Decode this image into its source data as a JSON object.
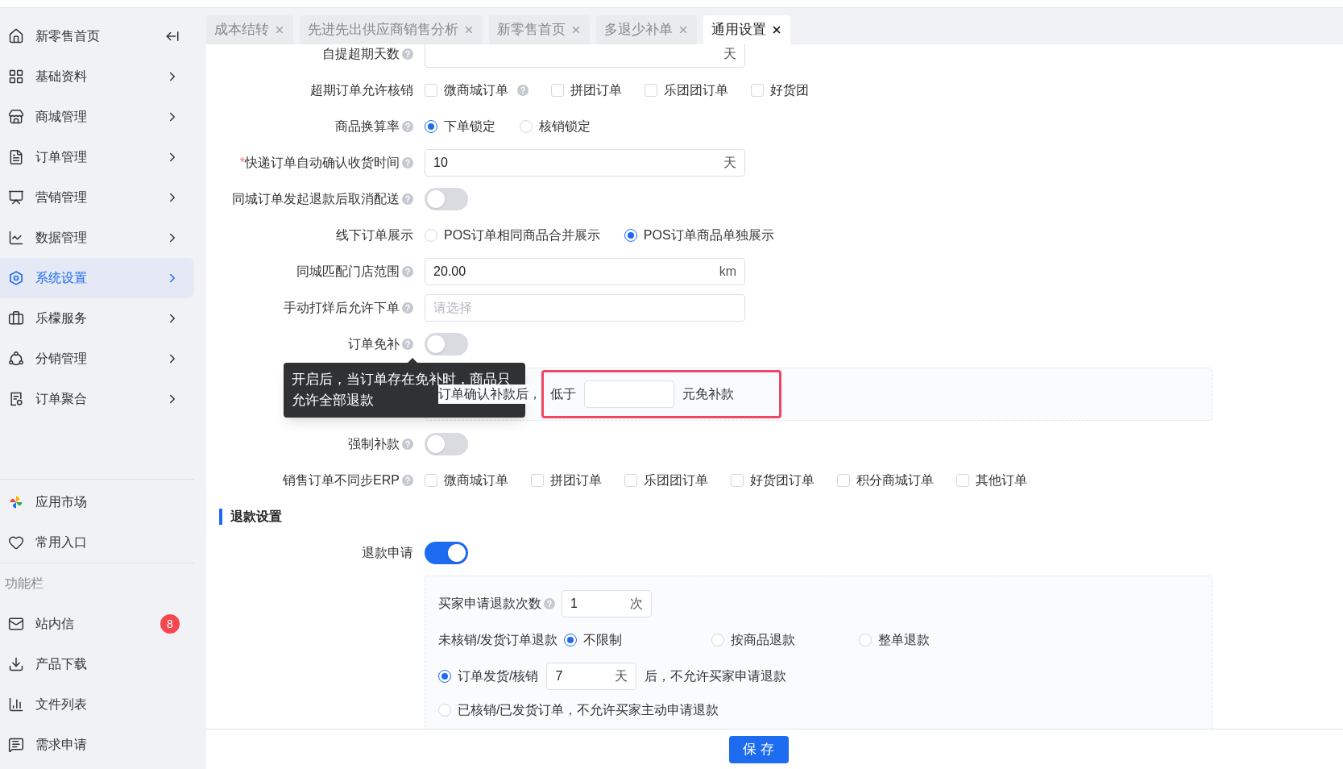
{
  "sidebar": {
    "menu": [
      {
        "label": "新零售首页",
        "kind": "home",
        "selected": false
      },
      {
        "label": "基础资料",
        "kind": "grid",
        "selected": false
      },
      {
        "label": "商城管理",
        "kind": "store",
        "selected": false
      },
      {
        "label": "订单管理",
        "kind": "order",
        "selected": false
      },
      {
        "label": "营销管理",
        "kind": "marketing",
        "selected": false
      },
      {
        "label": "数据管理",
        "kind": "data",
        "selected": false
      },
      {
        "label": "系统设置",
        "kind": "settings",
        "selected": true
      },
      {
        "label": "乐檬服务",
        "kind": "service",
        "selected": false
      },
      {
        "label": "分销管理",
        "kind": "distribution",
        "selected": false
      },
      {
        "label": "订单聚合",
        "kind": "aggregate",
        "selected": false
      }
    ],
    "apps": [
      {
        "label": "应用市场",
        "kind": "market"
      },
      {
        "label": "常用入口",
        "kind": "favorite"
      }
    ],
    "section_title": "功能栏",
    "tools": [
      {
        "label": "站内信",
        "kind": "mail",
        "badge": "8"
      },
      {
        "label": "产品下载",
        "kind": "download"
      },
      {
        "label": "文件列表",
        "kind": "files"
      },
      {
        "label": "需求申请",
        "kind": "request"
      }
    ]
  },
  "tabs": [
    {
      "label": "成本结转",
      "selected": false
    },
    {
      "label": "先进先出供应商销售分析",
      "selected": false
    },
    {
      "label": "新零售首页",
      "selected": false
    },
    {
      "label": "多退少补单",
      "selected": false
    },
    {
      "label": "通用设置",
      "selected": true
    }
  ],
  "form": [
    {
      "kind": "input",
      "label": "自提超期天数",
      "help": true,
      "suffix": "天"
    },
    {
      "kind": "checkboxes",
      "label": "超期订单允许核销",
      "help": false,
      "options": [
        {
          "label": "微商城订单",
          "checked": false,
          "help": true
        },
        {
          "label": "拼团订单",
          "checked": false,
          "help": false
        },
        {
          "label": "乐团团订单",
          "checked": false,
          "help": false
        },
        {
          "label": "好货团",
          "checked": false,
          "help": false
        }
      ]
    },
    {
      "kind": "radios",
      "label": "商品换算率",
      "help": true,
      "options": [
        {
          "label": "下单锁定",
          "selected": true
        },
        {
          "label": "核销锁定",
          "selected": false
        }
      ]
    },
    {
      "kind": "input",
      "label": "快递订单自动确认收货时间",
      "required_mark": "*",
      "help": true,
      "value": "10",
      "suffix": "天"
    },
    {
      "kind": "switch",
      "label": "同城订单发起退款后取消配送",
      "help": true,
      "on": false
    },
    {
      "kind": "radios",
      "label": "线下订单展示",
      "help": false,
      "options": [
        {
          "label": "POS订单相同商品合并展示",
          "selected": false
        },
        {
          "label": "POS订单商品单独展示",
          "selected": true
        }
      ]
    },
    {
      "kind": "input",
      "label": "同城匹配门店范围",
      "help": true,
      "value": "20.00",
      "suffix": "km"
    },
    {
      "kind": "input",
      "label": "手动打烊后允许下单",
      "help": true,
      "placeholder": "请选择"
    },
    {
      "kind": "switch",
      "label": "订单免补",
      "help": true,
      "on": false,
      "tooltip": "开启后，当订单存在免补时，商品只允许全部退款"
    },
    {
      "kind": "threshold",
      "text": "订单确认补款后，",
      "prefix": "低于",
      "suffix": "元免补款",
      "highlighted": true
    },
    {
      "kind": "switch",
      "label": "强制补款",
      "help": true,
      "on": false
    },
    {
      "kind": "checkboxes",
      "label": "销售订单不同步ERP",
      "help": true,
      "options": [
        {
          "label": "微商城订单",
          "checked": false,
          "help": false
        },
        {
          "label": "拼团订单",
          "checked": false,
          "help": false
        },
        {
          "label": "乐团团订单",
          "checked": false,
          "help": false
        },
        {
          "label": "好货团订单",
          "checked": false,
          "help": false
        },
        {
          "label": "积分商城订单",
          "checked": false,
          "help": false
        },
        {
          "label": "其他订单",
          "checked": false,
          "help": false
        }
      ]
    }
  ],
  "refund": {
    "title": "退款设置",
    "switch": {
      "label": "退款申请",
      "help": false,
      "on": true
    },
    "rows": [
      {
        "kind": "count",
        "label": "买家申请退款次数",
        "help": true,
        "value": "1",
        "suffix": "次"
      },
      {
        "kind": "radios",
        "label": "未核销/发货订单退款",
        "options": [
          {
            "label": "不限制",
            "selected": true
          },
          {
            "label": "按商品退款",
            "selected": false
          },
          {
            "label": "整单退款",
            "selected": false
          }
        ]
      },
      {
        "kind": "radio_days",
        "label": "订单发货/核销",
        "selected": true,
        "value": "7",
        "suffix": "天",
        "after": "后，不允许买家申请退款"
      },
      {
        "kind": "radio_text",
        "label": "已核销/已发货订单，不允许买家主动申请退款",
        "selected": false
      }
    ]
  },
  "save_button": "保 存"
}
